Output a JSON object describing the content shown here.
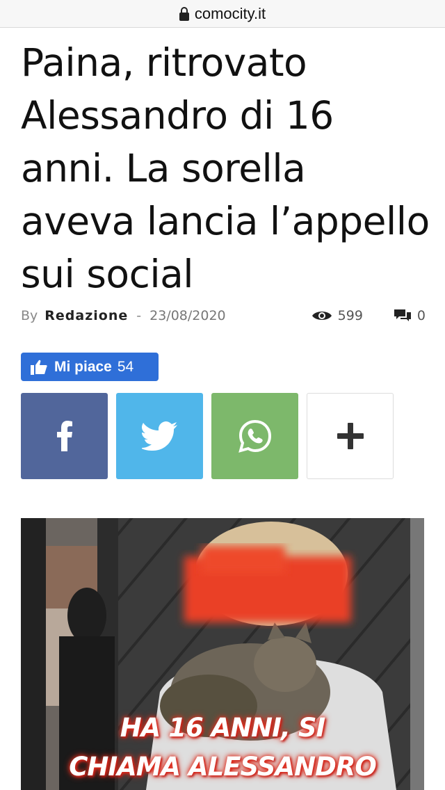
{
  "browser": {
    "url": "comocity.it",
    "lock_icon": "lock-icon"
  },
  "article": {
    "title": "Paina, ritrovato Alessandro di 16 anni. La sorella aveva lancia l’appello sui social",
    "by_label": "By",
    "author": "Redazione",
    "separator": "-",
    "date": "23/08/2020",
    "views": "599",
    "comments": "0"
  },
  "like": {
    "label": "Mi piace",
    "count": "54",
    "color": "#2f6fd8"
  },
  "share": {
    "facebook_color": "#51669b",
    "twitter_color": "#50b6ea",
    "whatsapp_color": "#7db86b"
  },
  "photo": {
    "caption_line1": "HA 16 ANNI, SI",
    "caption_line2": "CHIAMA ALESSANDRO"
  }
}
